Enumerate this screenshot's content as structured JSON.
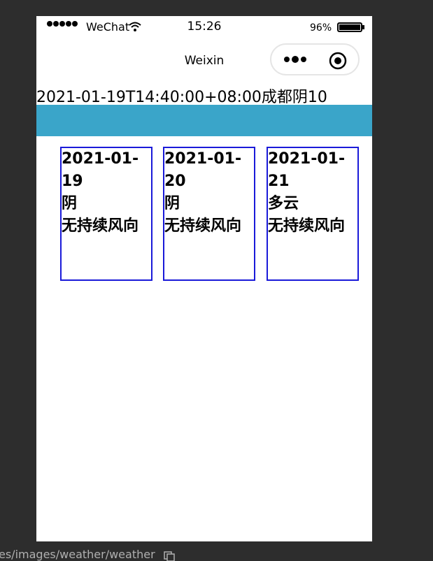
{
  "status_bar": {
    "carrier": "WeChat",
    "time": "15:26",
    "battery": "96%"
  },
  "nav": {
    "title": "Weixin"
  },
  "content": {
    "info_line": "2021-01-19T14:40:00+08:00成都阴10",
    "accent_color": "#3aa5c9",
    "card_border_color": "#1a1ad9"
  },
  "forecast": [
    {
      "date": "2021-01-19",
      "weather": "阴",
      "wind": "无持续风向"
    },
    {
      "date": "2021-01-20",
      "weather": "阴",
      "wind": "无持续风向"
    },
    {
      "date": "2021-01-21",
      "weather": "多云",
      "wind": "无持续风向"
    }
  ],
  "path_bar": {
    "path": "es/images/weather/weather"
  }
}
